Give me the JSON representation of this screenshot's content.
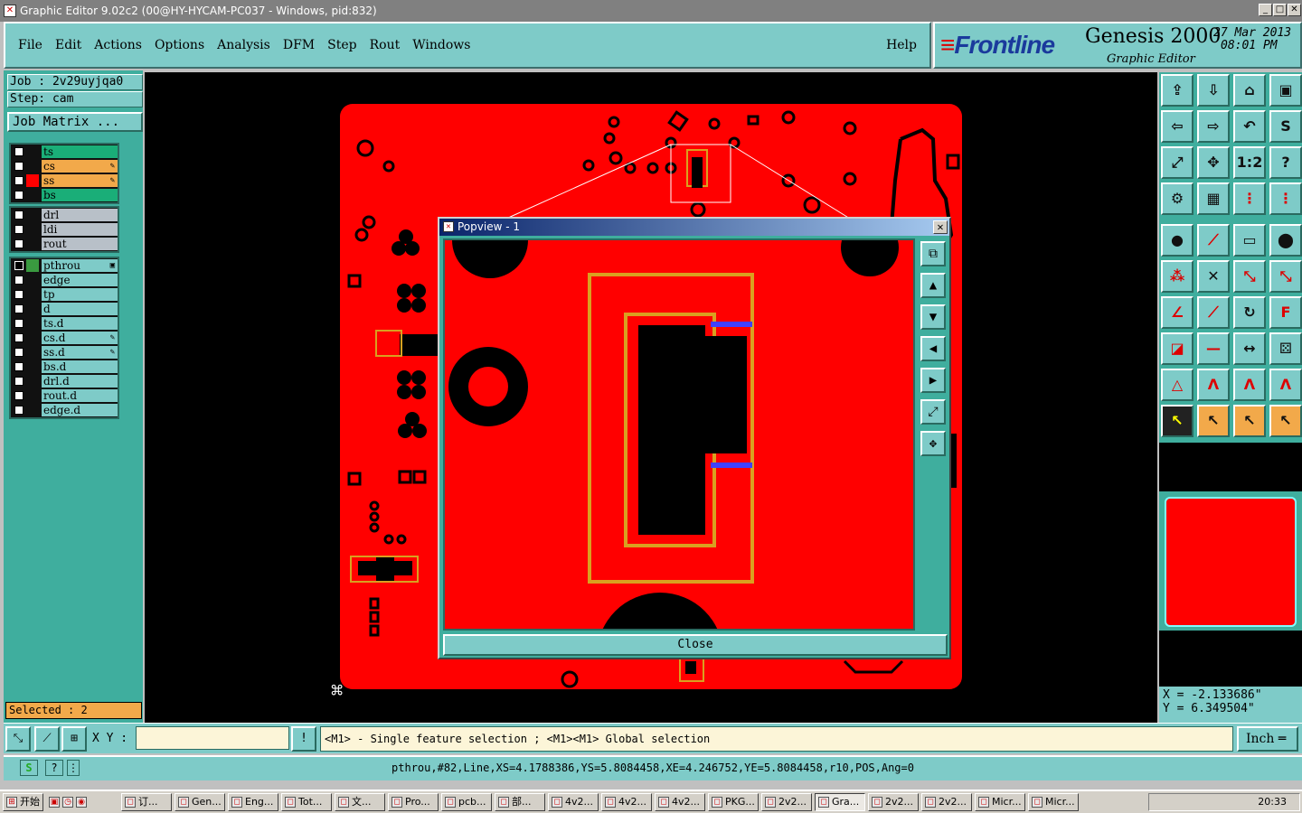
{
  "window": {
    "title": "Graphic Editor 9.02c2 (00@HY-HYCAM-PC037 - Windows, pid:832)",
    "app_icon": "x-icon",
    "buttons": [
      "_",
      "□",
      "✕"
    ]
  },
  "menu": {
    "items": [
      "File",
      "Edit",
      "Actions",
      "Options",
      "Analysis",
      "DFM",
      "Step",
      "Rout",
      "Windows"
    ],
    "help": "Help"
  },
  "brand": {
    "logo": "Frontline",
    "product": "Genesis 2000",
    "subtitle": "Graphic Editor",
    "date": "27 Mar 2013",
    "time": "08:01 PM"
  },
  "left_panel": {
    "job": "Job  : 2v29uyjqa0",
    "step": "Step: cam",
    "job_matrix": "Job Matrix ...",
    "groups": [
      [
        {
          "name": "ts",
          "color": "#1aae78",
          "swatch": "#111",
          "mark": ""
        },
        {
          "name": "cs",
          "color": "#f2a94a",
          "swatch": "#111",
          "mark": "✎"
        },
        {
          "name": "ss",
          "color": "#f2a94a",
          "swatch": "#ff0000",
          "mark": "✎"
        },
        {
          "name": "bs",
          "color": "#1aae78",
          "swatch": "#111",
          "mark": ""
        }
      ],
      [
        {
          "name": "drl",
          "color": "#b8c0c8",
          "swatch": "#111",
          "mark": ""
        },
        {
          "name": "ldi",
          "color": "#b8c0c8",
          "swatch": "#111",
          "mark": ""
        },
        {
          "name": "rout",
          "color": "#b8c0c8",
          "swatch": "#111",
          "mark": ""
        }
      ],
      [
        {
          "name": "pthrou",
          "color": "#7ecbc8",
          "swatch": "#3a9a40",
          "mark": "▣",
          "checked": true
        },
        {
          "name": "edge",
          "color": "#7ecbc8",
          "swatch": "#111",
          "mark": ""
        },
        {
          "name": "tp",
          "color": "#7ecbc8",
          "swatch": "#111",
          "mark": ""
        },
        {
          "name": "d",
          "color": "#7ecbc8",
          "swatch": "#111",
          "mark": ""
        },
        {
          "name": "ts.d",
          "color": "#7ecbc8",
          "swatch": "#111",
          "mark": ""
        },
        {
          "name": "cs.d",
          "color": "#7ecbc8",
          "swatch": "#111",
          "mark": "✎"
        },
        {
          "name": "ss.d",
          "color": "#7ecbc8",
          "swatch": "#111",
          "mark": "✎"
        },
        {
          "name": "bs.d",
          "color": "#7ecbc8",
          "swatch": "#111",
          "mark": ""
        },
        {
          "name": "drl.d",
          "color": "#7ecbc8",
          "swatch": "#111",
          "mark": ""
        },
        {
          "name": "rout.d",
          "color": "#7ecbc8",
          "swatch": "#111",
          "mark": ""
        },
        {
          "name": "edge.d",
          "color": "#7ecbc8",
          "swatch": "#111",
          "mark": ""
        }
      ]
    ],
    "selected": "Selected : 2"
  },
  "popview": {
    "title": "Popview - 1",
    "close_label": "Close"
  },
  "coords": {
    "x": "X = -2.133686\"",
    "y": "Y = 6.349504\""
  },
  "cmd": {
    "xy_label": "X Y :",
    "xy_value": "",
    "hint": "<M1> - Single feature selection ; <M1><M1> Global selection",
    "units": "Inch"
  },
  "status": {
    "text": "pthrou,#82,Line,XS=4.1788386,YS=5.8084458,XE=4.246752,YE=5.8084458,r10,POS,Ang=0"
  },
  "taskbar": {
    "start": "开始",
    "items": [
      "订...",
      "Gen...",
      "Eng...",
      "Tot...",
      "文...",
      "Pro...",
      "pcb...",
      "部...",
      "4v2...",
      "4v2...",
      "4v2...",
      "PKG...",
      "2v2...",
      "Gra...",
      "2v2...",
      "2v2...",
      "Micr...",
      "Micr..."
    ],
    "active_index": 13,
    "clock": "20:33"
  },
  "colors": {
    "board": "#ff0000",
    "panel": "#3fae9e",
    "panel_light": "#7ecbc8",
    "trace": "#d9a020",
    "highlight": "#4040ff"
  }
}
